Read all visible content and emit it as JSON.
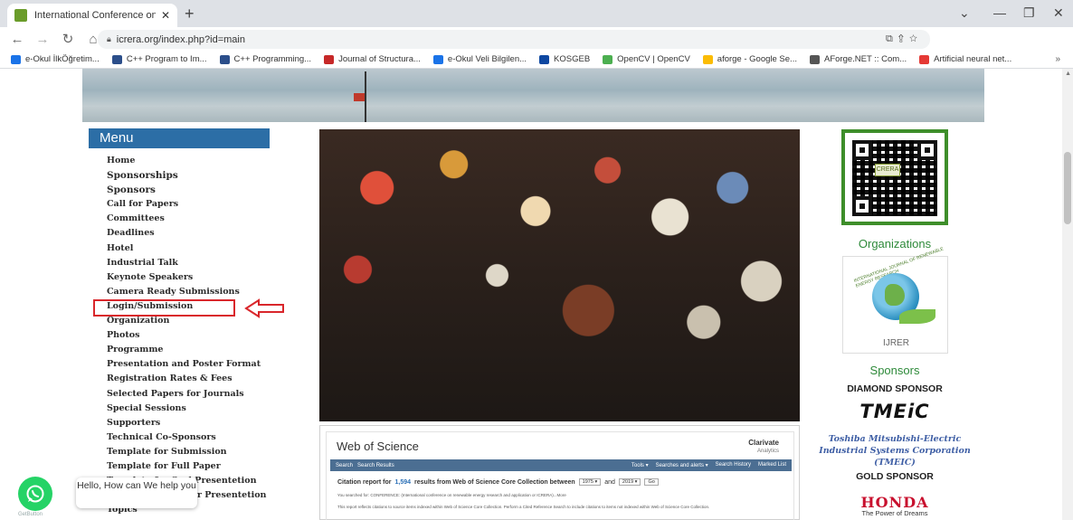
{
  "browser": {
    "tab_title": "International Conference on Rene",
    "new_tab_icon": "+",
    "url": "icrera.org/index.php?id=main",
    "bookmarks": [
      {
        "label": "e-Okul İlkÖğretim...",
        "color": "#1a73e8"
      },
      {
        "label": "C++ Program to Im...",
        "color": "#2b4e8a"
      },
      {
        "label": "C++ Programming...",
        "color": "#2b4e8a"
      },
      {
        "label": "Journal of Structura...",
        "color": "#c62828"
      },
      {
        "label": "e-Okul Veli Bilgilen...",
        "color": "#1a73e8"
      },
      {
        "label": "KOSGEB",
        "color": "#0d47a1"
      },
      {
        "label": "OpenCV | OpenCV",
        "color": "#4caf50"
      },
      {
        "label": "aforge - Google Se...",
        "color": "#fbbc05"
      },
      {
        "label": "AForge.NET :: Com...",
        "color": "#555555"
      },
      {
        "label": "Artificial neural net...",
        "color": "#e53935"
      }
    ],
    "more_bookmarks": "»"
  },
  "menu": {
    "title": "Menu",
    "items": [
      "Home",
      "Sponsorships",
      "Sponsors",
      "Call for Papers",
      "Committees",
      "Deadlines",
      "Hotel",
      "Industrial Talk",
      "Keynote Speakers",
      "Camera Ready Submissions",
      "Login/Submission",
      "Organization",
      "Photos",
      "Programme",
      "Presentation and Poster Format",
      "Registration Rates & Fees",
      "Selected Papers for Journals",
      "Special Sessions",
      "Supporters",
      "Technical Co-Sponsors",
      "Template for Submission",
      "Template for Full Paper",
      "Template for Oral Presentetion",
      "Template for Poster Presentetion",
      "Topics"
    ],
    "highlighted": "Login/Submission"
  },
  "wos": {
    "title": "Web of Science",
    "brand": "Clarivate",
    "brand_sub": "Analytics",
    "nav_left": [
      "Search",
      "Search Results"
    ],
    "nav_right": [
      "Tools ▾",
      "Searches and alerts ▾",
      "Search History",
      "Marked List"
    ],
    "citation_prefix": "Citation report for",
    "citation_count": "1,594",
    "citation_suffix": "results from Web of Science Core Collection  between",
    "year_from": "1975",
    "and_label": "and",
    "year_to": "2019",
    "go_label": "Go",
    "searched_for": "You searched for: CONFERENCE: (International conference on renewable energy research and application or ICRERA)...More",
    "reflects": "This report reflects citations to source items indexed within Web of Science Core Collection. Perform a Cited Reference Search to include citations to items not indexed within Web of Science Core Collection."
  },
  "right": {
    "qr_label": "CRERA",
    "organizations_heading": "Organizations",
    "ijrer_text": "IJRER",
    "ijrer_arc": "INTERNATIONAL JOURNAL OF RENEWABLE ENERGY RESEARCH",
    "sponsors_heading": "Sponsors",
    "diamond_label": "DIAMOND SPONSOR",
    "tmeic_logo": "TMEiC",
    "tmeic_desc": "Toshiba Mitsubishi-Electric Industrial Systems Corporation (TMEIC)",
    "gold_label": "GOLD SPONSOR",
    "honda_logo": "HONDA",
    "honda_tagline": "The Power of Dreams"
  },
  "chat": {
    "bubble": "Hello, How can We help you",
    "label": "GetButton"
  },
  "colors": {
    "menu_header": "#2c6ea6",
    "highlight": "#d9262b",
    "section_green": "#2e8a3a"
  }
}
